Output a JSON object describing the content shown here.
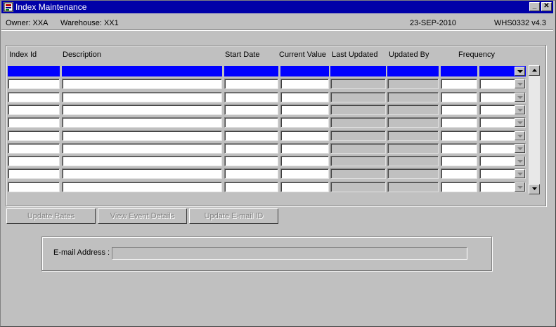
{
  "window": {
    "title": "Index Maintenance",
    "minimize_label": "_",
    "close_label": "✕"
  },
  "header": {
    "owner": "Owner:  XXA",
    "warehouse": "Warehouse:  XX1",
    "date": "23-SEP-2010",
    "form_id": "WHS0332  v4.3"
  },
  "grid": {
    "columns": [
      "Index Id",
      "Description",
      "Start Date",
      "Current Value",
      "Last Updated",
      "Updated By",
      "Frequency"
    ],
    "row_count": 10,
    "selected_row": 1,
    "selection_color": "#0000ff"
  },
  "buttons": {
    "update_rates": "Update Rates",
    "view_event_details": "View Event Details",
    "update_email_id": "Update E-mail ID"
  },
  "email": {
    "label": "E-mail Address :",
    "value": ""
  }
}
